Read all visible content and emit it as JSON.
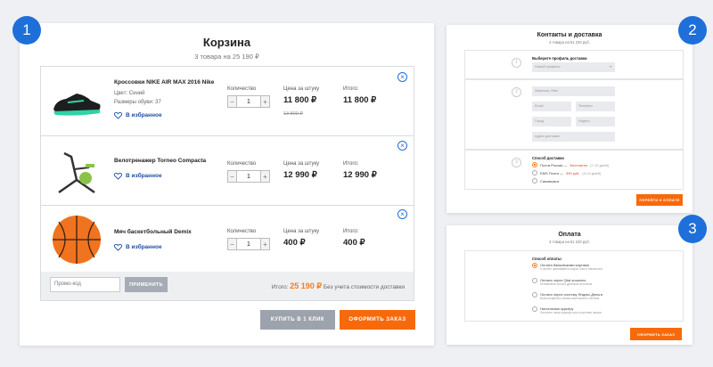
{
  "steps": [
    "1",
    "2",
    "3"
  ],
  "cart": {
    "title": "Корзина",
    "subtitle": "3 товара на 25 190 ₽",
    "col_qty": "Количество",
    "col_unit": "Цена за штуку",
    "col_total": "Итого:",
    "favorite": "В избранное",
    "items": [
      {
        "name": "Кроссовки NIKE AIR MAX 2016 Nike",
        "meta1": "Цвет: Синий",
        "meta2": "Размеры обуви: 37",
        "qty": "1",
        "price": "11 800 ₽",
        "old_price": "13 800 ₽",
        "total": "11 800 ₽",
        "icon": "sneaker-image"
      },
      {
        "name": "Велотренажер Torneo Compacta",
        "qty": "1",
        "price": "12 990 ₽",
        "total": "12 990 ₽",
        "icon": "exercise-bike-image"
      },
      {
        "name": "Мяч баскетбольный Demix",
        "qty": "1",
        "price": "400 ₽",
        "total": "400 ₽",
        "icon": "basketball-image"
      }
    ],
    "promo_placeholder": "Промо-код",
    "apply_label": "ПРИМЕНИТЬ",
    "total_label": "Итого:",
    "total_value": "25 190 ₽",
    "total_note": "Без учета стоимости доставки",
    "one_click_label": "КУПИТЬ В 1 КЛИК",
    "checkout_label": "ОФОРМИТЬ ЗАКАЗ"
  },
  "contacts": {
    "title": "Контакты и доставка",
    "subtitle": "3 товара на 51 220 руб.",
    "profile_label": "Выберите профиль доставки",
    "profile_value": "Новый профиль",
    "fields": [
      "Фамилия, Имя",
      "Email",
      "Телефон",
      "Город",
      "Индекс",
      "Адрес доставки"
    ],
    "delivery_label": "Способ доставки",
    "delivery_opts": [
      {
        "a": "Почта России —",
        "b": "Бесплатно",
        "c": "(7-10 дней)"
      },
      {
        "a": "EMS Почта —",
        "b": "390 руб.",
        "c": "(3-14 дней)"
      },
      {
        "a": "Самовывоз",
        "b": "",
        "c": ""
      }
    ],
    "next_label": "ПЕРЕЙТИ К ОПЛАТЕ",
    "steps": [
      "1",
      "2",
      "3"
    ]
  },
  "payment": {
    "title": "Оплата",
    "subtitle": "3 товара на 51 220 руб.",
    "method_label": "Способ оплаты:",
    "options": [
      {
        "name": "Оплата банковскими картами",
        "desc": "К оплате принимаются карты Visa и Mastercard"
      },
      {
        "name": "Оплата через Qiwi-кошелек",
        "desc": "Мгновенная оплата удобным способом"
      },
      {
        "name": "Оплата через систему Яндекс.Деньги",
        "desc": "Воспользуйтесь своим кошельком в системе"
      },
      {
        "name": "Наличными курьеру",
        "desc": "Оплатите заказ курьеру при получении заказа"
      }
    ],
    "order_label": "ОФОРМИТЬ ЗАКАЗ"
  }
}
